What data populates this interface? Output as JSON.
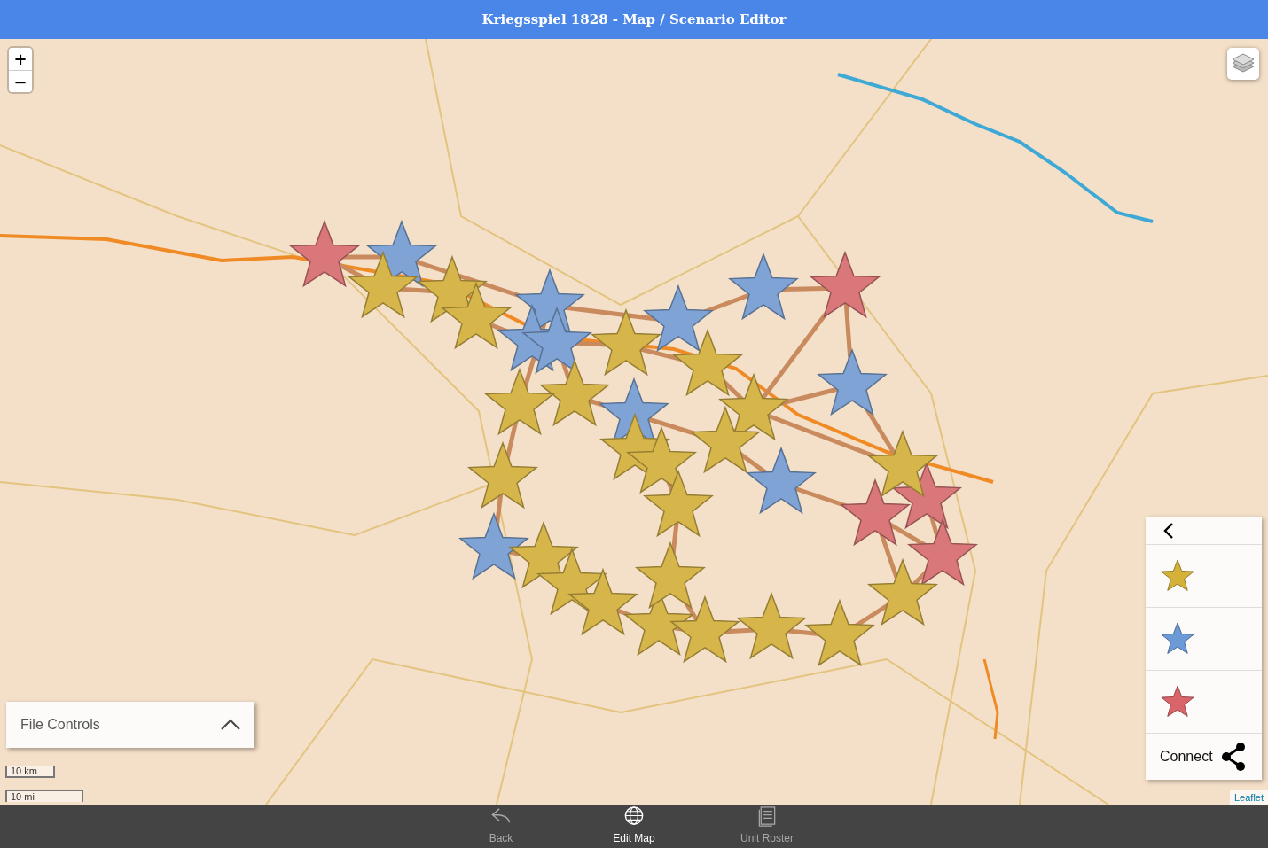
{
  "window": {
    "title": "Kriegsspiel 1828 - Map / Scenario Editor"
  },
  "map": {
    "zoom_in": "+",
    "zoom_out": "−",
    "markers": [
      {
        "color": "#d9777a"
      },
      {
        "color": "#d9777a"
      },
      {
        "color": "#d9777a"
      },
      {
        "color": "#d9777a"
      },
      {
        "color": "#d9777a"
      },
      {
        "color": "#7fa3d4"
      },
      {
        "color": "#7fa3d4"
      },
      {
        "color": "#7fa3d4"
      },
      {
        "color": "#7fa3d4"
      },
      {
        "color": "#7fa3d4"
      },
      {
        "color": "#7fa3d4"
      },
      {
        "color": "#7fa3d4"
      },
      {
        "color": "#7fa3d4"
      },
      {
        "color": "#7fa3d4"
      },
      {
        "color": "#7fa3d4"
      },
      {
        "color": "#d6b54a"
      },
      {
        "color": "#d6b54a"
      },
      {
        "color": "#d6b54a"
      },
      {
        "color": "#d6b54a"
      },
      {
        "color": "#d6b54a"
      },
      {
        "color": "#d6b54a"
      },
      {
        "color": "#d6b54a"
      },
      {
        "color": "#d6b54a"
      },
      {
        "color": "#d6b54a"
      },
      {
        "color": "#d6b54a"
      },
      {
        "color": "#d6b54a"
      },
      {
        "color": "#d6b54a"
      },
      {
        "color": "#d6b54a"
      },
      {
        "color": "#d6b54a"
      },
      {
        "color": "#d6b54a"
      },
      {
        "color": "#d6b54a"
      },
      {
        "color": "#d6b54a"
      },
      {
        "color": "#d6b54a"
      },
      {
        "color": "#d6b54a"
      },
      {
        "color": "#d6b54a"
      },
      {
        "color": "#d6b54a"
      },
      {
        "color": "#d6b54a"
      },
      {
        "color": "#d6b54a"
      }
    ],
    "scale": {
      "metric": "10 km",
      "imperial": "10 mi"
    },
    "attribution": "Leaflet"
  },
  "file_controls": {
    "label": "File Controls",
    "expanded": false
  },
  "palette": {
    "tools": [
      {
        "color": "#d4b23a"
      },
      {
        "color": "#6b9ad6"
      },
      {
        "color": "#d9646a"
      }
    ],
    "connect": "Connect"
  },
  "tabs": [
    {
      "label": "Back",
      "kind": "back",
      "selected": false
    },
    {
      "label": "Edit Map",
      "kind": "map",
      "selected": true
    },
    {
      "label": "Unit Roster",
      "kind": "roster",
      "selected": false
    }
  ]
}
